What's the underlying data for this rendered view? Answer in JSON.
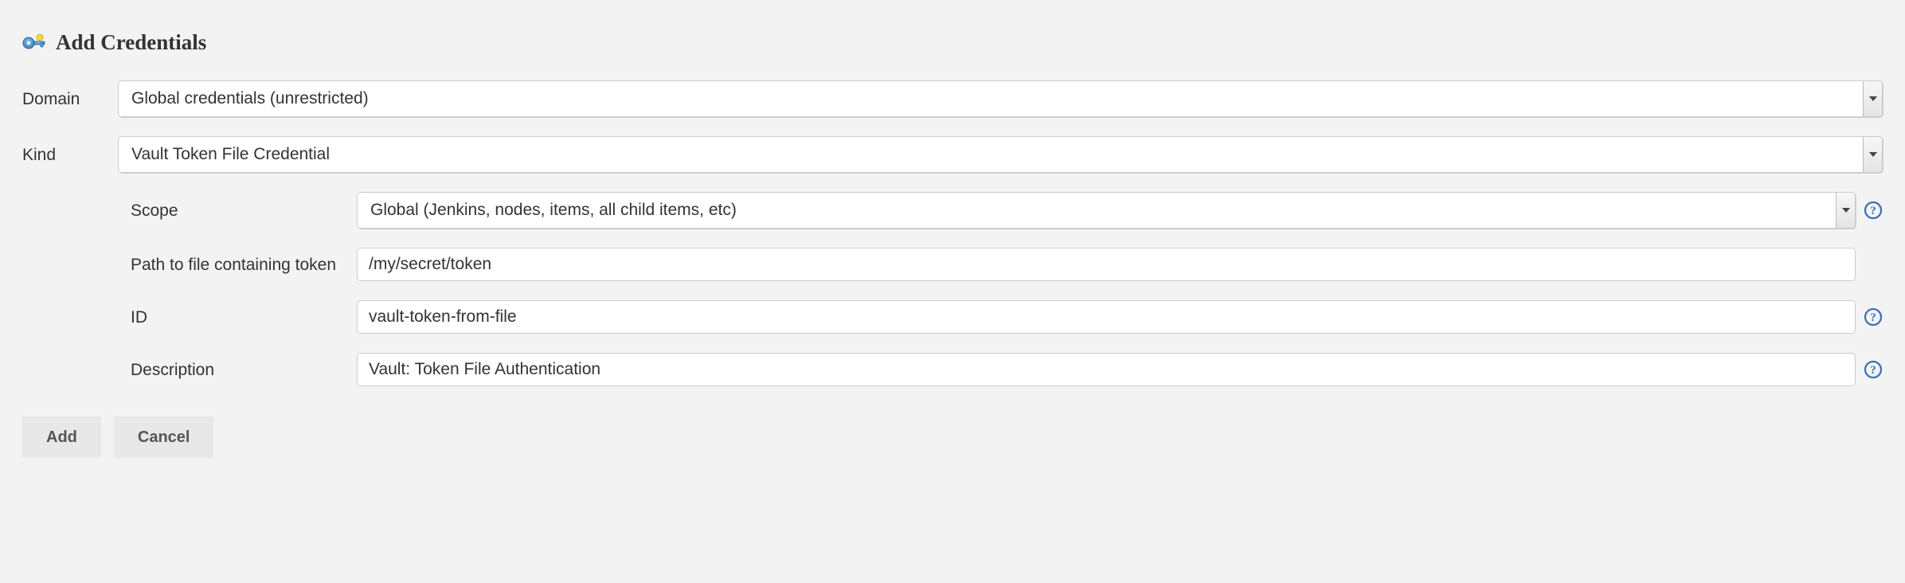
{
  "page_title": "Add Credentials",
  "labels": {
    "domain": "Domain",
    "kind": "Kind",
    "scope": "Scope",
    "path": "Path to file containing token",
    "id": "ID",
    "description": "Description"
  },
  "fields": {
    "domain_value": "Global credentials (unrestricted)",
    "kind_value": "Vault Token File Credential",
    "scope_value": "Global (Jenkins, nodes, items, all child items, etc)",
    "path_value": "/my/secret/token",
    "id_value": "vault-token-from-file",
    "description_value": "Vault: Token File Authentication"
  },
  "buttons": {
    "add": "Add",
    "cancel": "Cancel"
  }
}
